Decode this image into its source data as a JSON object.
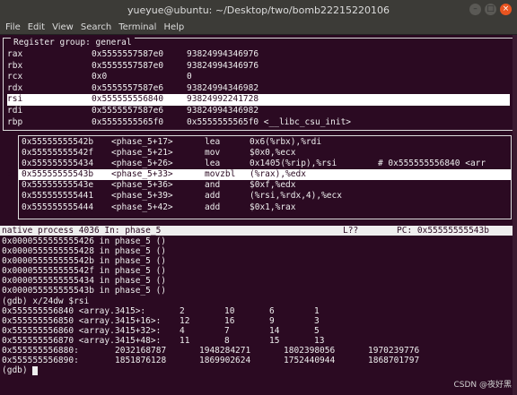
{
  "window": {
    "title": "yueyue@ubuntu: ~/Desktop/two/bomb22215220106"
  },
  "menu": [
    "File",
    "Edit",
    "View",
    "Search",
    "Terminal",
    "Help"
  ],
  "registers": {
    "title": "Register group: general",
    "rows": [
      {
        "name": "rax",
        "hex": "0x5555557587e0",
        "val": "93824994346976"
      },
      {
        "name": "rbx",
        "hex": "0x5555557587e0",
        "val": "93824994346976"
      },
      {
        "name": "rcx",
        "hex": "0x0",
        "val": "0"
      },
      {
        "name": "rdx",
        "hex": "0x5555557587e6",
        "val": "93824994346982"
      },
      {
        "name": "rsi",
        "hex": "0x555555556840",
        "val": "93824992241728"
      },
      {
        "name": "rdi",
        "hex": "0x5555557587e6",
        "val": "93824994346982"
      },
      {
        "name": "rbp",
        "hex": "0x5555555565f0",
        "val": "0x5555555565f0 <__libc_csu_init>"
      }
    ]
  },
  "asm": [
    {
      "marker": "",
      "addr": "0x55555555542b",
      "fn": "<phase_5+17>",
      "op": "lea",
      "args": "0x6(%rbx),%rdi"
    },
    {
      "marker": "",
      "addr": "0x55555555542f",
      "fn": "<phase_5+21>",
      "op": "mov",
      "args": "$0x0,%ecx"
    },
    {
      "marker": "",
      "addr": "0x555555555434",
      "fn": "<phase_5+26>",
      "op": "lea",
      "args": "0x1405(%rip),%rsi        # 0x555555556840 <arr"
    },
    {
      "marker": ">",
      "addr": "0x55555555543b",
      "fn": "<phase_5+33>",
      "op": "movzbl",
      "args": "(%rax),%edx"
    },
    {
      "marker": "",
      "addr": "0x55555555543e",
      "fn": "<phase_5+36>",
      "op": "and",
      "args": "$0xf,%edx"
    },
    {
      "marker": "",
      "addr": "0x555555555441",
      "fn": "<phase_5+39>",
      "op": "add",
      "args": "(%rsi,%rdx,4),%ecx"
    },
    {
      "marker": "",
      "addr": "0x555555555444",
      "fn": "<phase_5+42>",
      "op": "add",
      "args": "$0x1,%rax"
    }
  ],
  "status": {
    "proc": "native process 4036 In: phase_5",
    "line": "L??",
    "pc": "PC: 0x55555555543b"
  },
  "history": [
    "0x0000555555555426 in phase_5 ()",
    "0x0000555555555428 in phase_5 ()",
    "0x000055555555542b in phase_5 ()",
    "0x000055555555542f in phase_5 ()",
    "0x0000555555555434 in phase_5 ()",
    "0x000055555555543b in phase_5 ()"
  ],
  "command": "(gdb) x/24dw $rsi",
  "mem_rows": [
    {
      "addr": "0x555555556840 <array.3415>:",
      "vals": [
        "2",
        "10",
        "6",
        "1"
      ]
    },
    {
      "addr": "0x555555556850 <array.3415+16>:",
      "vals": [
        "12",
        "16",
        "9",
        "3"
      ]
    },
    {
      "addr": "0x555555556860 <array.3415+32>:",
      "vals": [
        "4",
        "7",
        "14",
        "5"
      ]
    },
    {
      "addr": "0x555555556870 <array.3415+48>:",
      "vals": [
        "11",
        "8",
        "15",
        "13"
      ]
    }
  ],
  "mem_rows2": [
    {
      "addr": "0x555555556880:",
      "vals": [
        "2032168787",
        "1948284271",
        "1802398056",
        "1970239776"
      ]
    },
    {
      "addr": "0x555555556890:",
      "vals": [
        "1851876128",
        "1869902624",
        "1752440944",
        "1868701797"
      ]
    }
  ],
  "prompt": "(gdb) ",
  "watermark": "CSDN @夜好黑"
}
